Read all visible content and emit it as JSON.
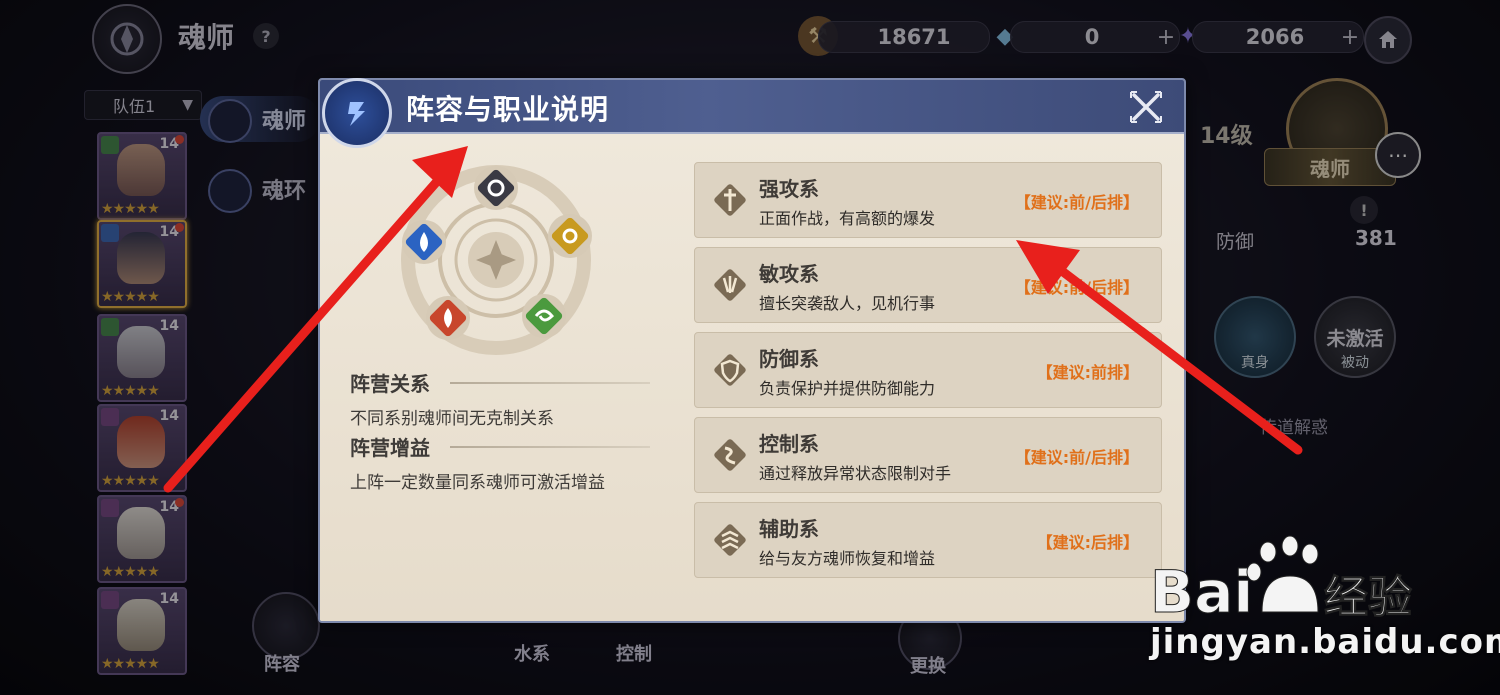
{
  "top_bar": {
    "title": "魂师",
    "help_label": "?",
    "resources": [
      {
        "name": "coins",
        "value": "18671",
        "icon": "hammer-coin-icon",
        "has_plus": false
      },
      {
        "name": "diamond",
        "value": "0",
        "icon": "diamond-icon",
        "has_plus": true
      },
      {
        "name": "crystal",
        "value": "2066",
        "icon": "crystal-icon",
        "has_plus": true
      }
    ],
    "plus_label": "+"
  },
  "roster": {
    "team_label": "队伍1",
    "heroes": [
      {
        "level": "14",
        "stars": "★★★★★"
      },
      {
        "level": "14",
        "stars": "★★★★★"
      },
      {
        "level": "14",
        "stars": "★★★★★"
      },
      {
        "level": "14",
        "stars": "★★★★★"
      },
      {
        "level": "14",
        "stars": "★★★★★"
      },
      {
        "level": "14",
        "stars": "★★★★★"
      }
    ],
    "side_tabs": [
      "魂师",
      "魂环"
    ]
  },
  "detail": {
    "level": "14级",
    "role": "魂师",
    "stat_label": "防御",
    "stat_value": "381",
    "skill_1": "真身",
    "skill_2_big": "未激活",
    "skill_2": "被动",
    "transfer": "传道解惑"
  },
  "bottom": {
    "lineup": "阵容",
    "water": "水系",
    "control": "控制",
    "swap": "更换"
  },
  "modal": {
    "title": "阵容与职业说明",
    "camp_relation_title": "阵营关系",
    "camp_relation_desc": "不同系别魂师间无克制关系",
    "camp_bonus_title": "阵营增益",
    "camp_bonus_desc": "上阵一定数量同系魂师可激活增益",
    "classes": [
      {
        "name": "强攻系",
        "desc": "正面作战，有高额的爆发",
        "rec": "【建议:前/后排】",
        "icon": "sword-icon"
      },
      {
        "name": "敏攻系",
        "desc": "擅长突袭敌人，见机行事",
        "rec": "【建议:前/后排】",
        "icon": "claw-icon"
      },
      {
        "name": "防御系",
        "desc": "负责保护并提供防御能力",
        "rec": "【建议:前排】",
        "icon": "shield-icon"
      },
      {
        "name": "控制系",
        "desc": "通过释放异常状态限制对手",
        "rec": "【建议:前/后排】",
        "icon": "chain-icon"
      },
      {
        "name": "辅助系",
        "desc": "给与友方魂师恢复和增益",
        "rec": "【建议:后排】",
        "icon": "support-icon"
      }
    ],
    "element_colors": {
      "light": "#3a3a44",
      "water": "#2b63c2",
      "sun": "#c89a1f",
      "fire": "#c8462c",
      "wind": "#4b9a3e"
    }
  },
  "watermark": {
    "brand": "Bai 经验",
    "url": "jingyan.baidu.com"
  },
  "colors": {
    "arrow": "#e8201c",
    "recommendation": "#e0701a",
    "modal_header": "#4f5f90"
  }
}
